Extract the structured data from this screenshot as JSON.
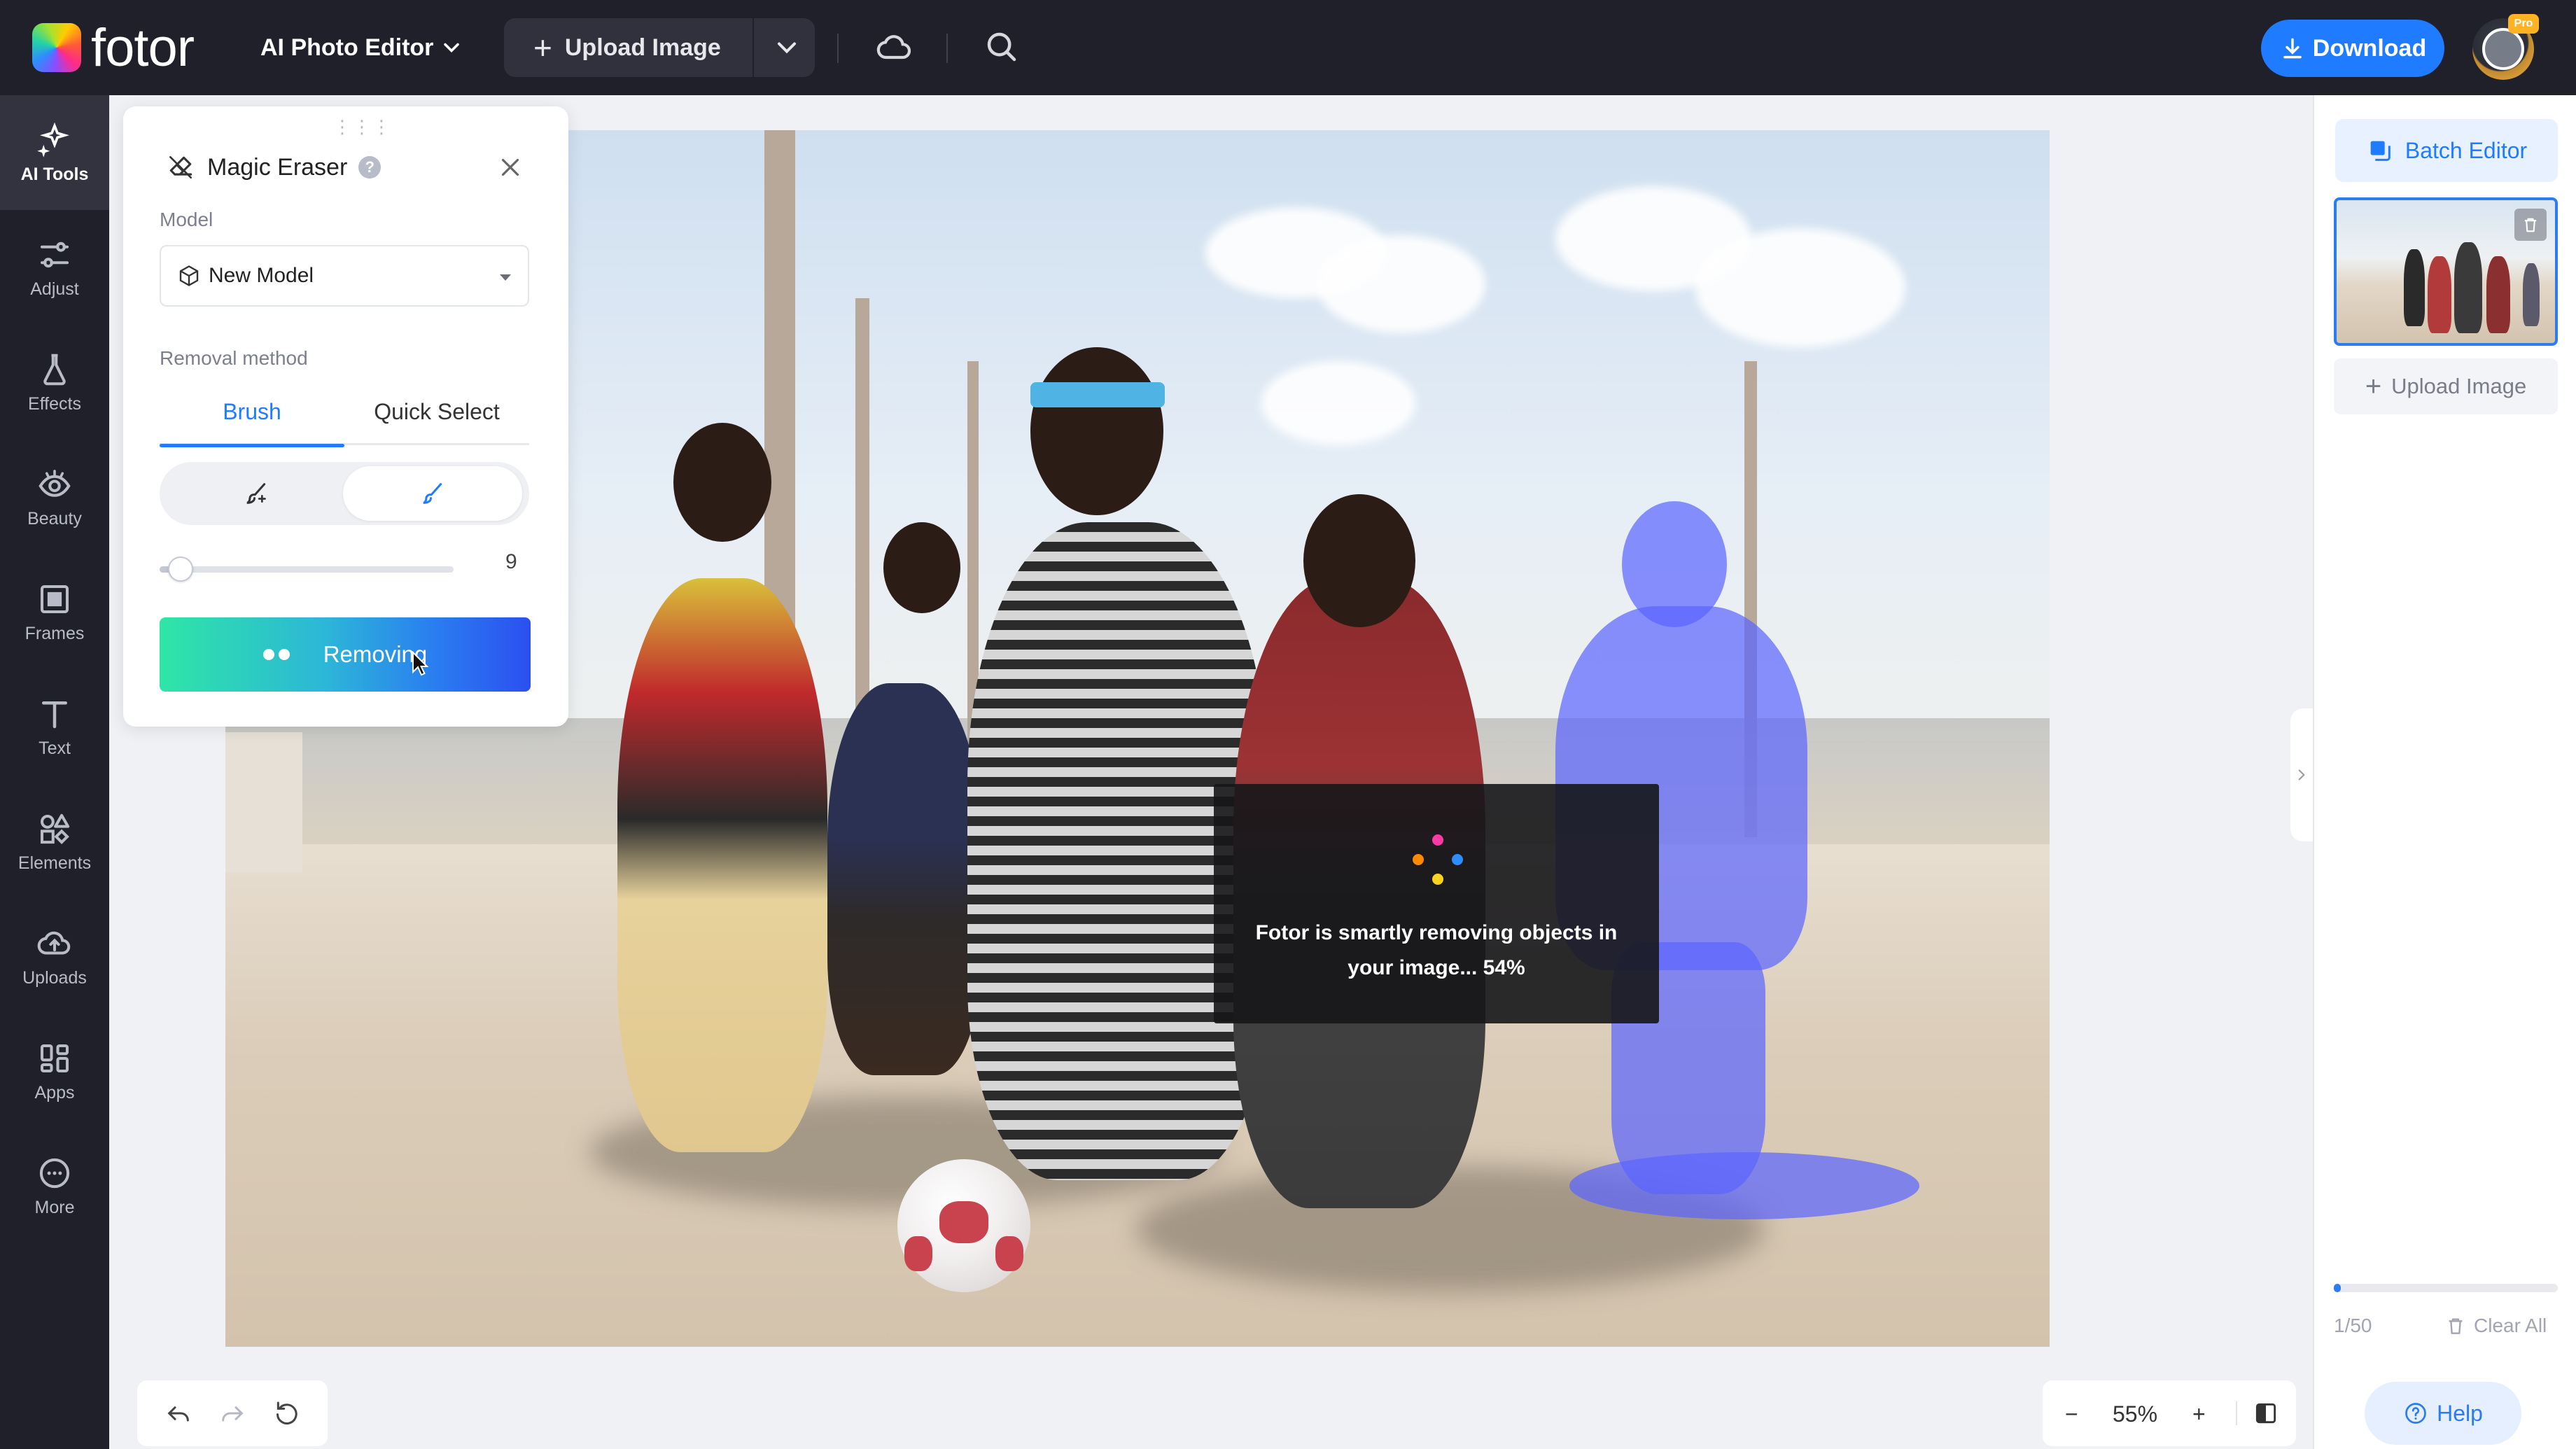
{
  "app": {
    "logo_text": "fotor"
  },
  "topbar": {
    "menu_label": "AI Photo Editor",
    "upload_label": "Upload Image",
    "download_label": "Download",
    "pro_badge": "Pro",
    "icons": [
      "cloud-icon",
      "search-icon",
      "download-icon",
      "chevron-down-icon"
    ]
  },
  "sidebar": {
    "items": [
      {
        "label": "AI Tools",
        "icon": "sparkle-icon",
        "active": true
      },
      {
        "label": "Adjust",
        "icon": "sliders-icon"
      },
      {
        "label": "Effects",
        "icon": "flask-icon"
      },
      {
        "label": "Beauty",
        "icon": "eye-icon"
      },
      {
        "label": "Frames",
        "icon": "frame-icon"
      },
      {
        "label": "Text",
        "icon": "text-icon"
      },
      {
        "label": "Elements",
        "icon": "shapes-icon"
      },
      {
        "label": "Uploads",
        "icon": "cloud-upload-icon"
      },
      {
        "label": "Apps",
        "icon": "apps-icon"
      },
      {
        "label": "More",
        "icon": "more-icon"
      }
    ]
  },
  "panel": {
    "title": "Magic Eraser",
    "model_label": "Model",
    "model_value": "New Model",
    "removal_method_label": "Removal method",
    "tabs": [
      {
        "label": "Brush",
        "active": true
      },
      {
        "label": "Quick Select",
        "active": false
      }
    ],
    "brush_size": "9",
    "brush_size_fraction": 0.03,
    "removing_label": "Removing"
  },
  "overlay": {
    "message": "Fotor is smartly removing objects in your image... 54%",
    "progress_percent": 54,
    "dot_colors": [
      "#ff3aa7",
      "#2f8cff",
      "#ffd21f",
      "#ff8a00"
    ]
  },
  "bottom": {
    "zoom_value": "55%",
    "zoom_out": "−",
    "zoom_in": "+"
  },
  "right_panel": {
    "batch_editor_label": "Batch Editor",
    "upload_label": "Upload Image",
    "count": "1/50",
    "count_fraction": 0.02,
    "clear_all_label": "Clear All",
    "help_label": "Help"
  },
  "colors": {
    "accent": "#1f7bff",
    "dark_bar": "#1f2029",
    "mask": "#5a64ff",
    "remove_gradient_start": "#2ee6a6",
    "remove_gradient_end": "#2c4ff0"
  }
}
